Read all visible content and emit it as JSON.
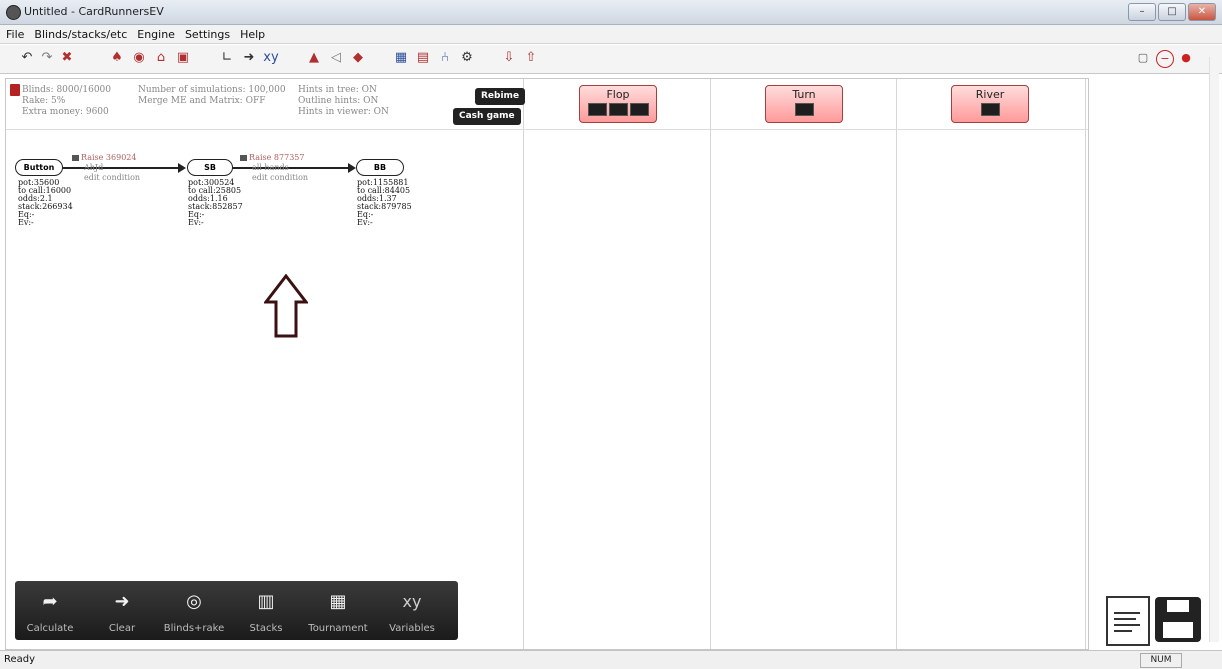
{
  "window": {
    "title": "Untitled - CardRunnersEV"
  },
  "menu": [
    "File",
    "Blinds/stacks/etc",
    "Engine",
    "Settings",
    "Help"
  ],
  "info": {
    "col1": [
      "Blinds: 8000/16000",
      "Rake: 5%",
      "Extra money: 9600"
    ],
    "col2": [
      "Number of simulations: 100,000",
      "Merge ME and Matrix: OFF"
    ],
    "col3": [
      "Hints in tree: ON",
      "Outline hints: ON",
      "Hints in viewer: ON"
    ]
  },
  "header_buttons": {
    "rebinmaster": "Rebime",
    "cash_game": "Cash game"
  },
  "streets": {
    "flop": "Flop",
    "turn": "Turn",
    "river": "River"
  },
  "tree": {
    "node1": {
      "label": "Button",
      "stats": [
        "pot:35600",
        "to call:16000",
        "odds:2.1",
        "stack:266934",
        "Eq:-",
        "Ev:-"
      ]
    },
    "action1": {
      "header": "Raise 369024",
      "lines": [
        "AhJd",
        "edit condition"
      ]
    },
    "node2": {
      "label": "SB",
      "stats": [
        "pot:300524",
        "to call:25805",
        "odds:1.16",
        "stack:852857",
        "Eq:-",
        "Ev:-"
      ]
    },
    "action2": {
      "header": "Raise 877357",
      "lines": [
        "all hands",
        "edit condition"
      ]
    },
    "node3": {
      "label": "BB",
      "stats": [
        "pot:1155881",
        "to call:84405",
        "odds:1.37",
        "stack:879785",
        "Eq:-",
        "Ev:-"
      ]
    }
  },
  "bottom_toolbar": [
    {
      "label": "Calculate",
      "icon": "calculator-arrow-icon"
    },
    {
      "label": "Clear",
      "icon": "right-arrow-icon"
    },
    {
      "label": "Blinds+rake",
      "icon": "chip-icon"
    },
    {
      "label": "Stacks",
      "icon": "stack-icon"
    },
    {
      "label": "Tournament",
      "icon": "tournament-icon"
    },
    {
      "label": "Variables",
      "icon": "xy-icon"
    }
  ],
  "status": {
    "text": "Ready",
    "num": "NUM"
  }
}
